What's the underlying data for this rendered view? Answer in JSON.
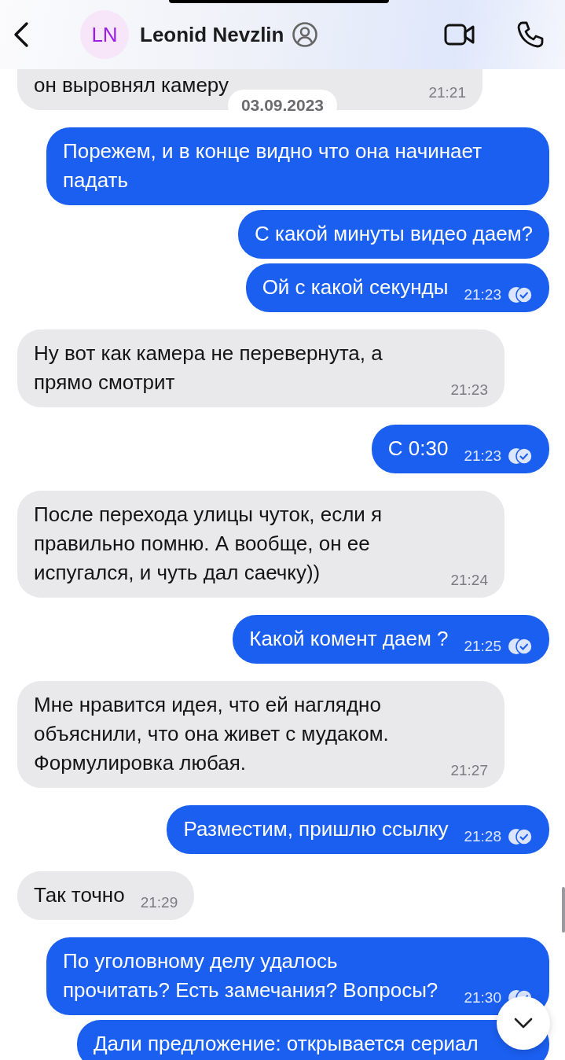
{
  "header": {
    "initials": "LN",
    "name": "Leonid Nevzlin"
  },
  "messages": [
    {
      "kind": "incoming",
      "text": "он выровнял камеру",
      "time": "21:21"
    },
    {
      "kind": "date",
      "text": "03.09.2023"
    },
    {
      "kind": "outgoing",
      "text": "Порежем, и в конце видно что она начинает падать"
    },
    {
      "kind": "outgoing",
      "text": "С какой минуты видео даем?"
    },
    {
      "kind": "outgoing",
      "text": "Ой с какой секунды",
      "time": "21:23",
      "read": true
    },
    {
      "kind": "incoming",
      "text": "Ну вот как камера не перевернута, а прямо смотрит",
      "time": "21:23"
    },
    {
      "kind": "outgoing",
      "text": "С 0:30",
      "time": "21:23",
      "read": true
    },
    {
      "kind": "incoming",
      "text": "После перехода улицы чуток, если я правильно помню. А вообще, он ее испугался, и чуть дал саечку))",
      "time": "21:24"
    },
    {
      "kind": "outgoing",
      "text": "Какой комент даем ?",
      "time": "21:25",
      "read": true
    },
    {
      "kind": "incoming",
      "text": "Мне нравится идея, что ей наглядно объяснили, что она живет с мудаком. Формулировка любая.",
      "time": "21:27"
    },
    {
      "kind": "outgoing",
      "text": "Разместим, пришлю ссылку",
      "time": "21:28",
      "read": true
    },
    {
      "kind": "incoming",
      "text": "Так точно",
      "time": "21:29"
    },
    {
      "kind": "outgoing",
      "text": "По уголовному делу удалось прочитать? Есть замечания? Вопросы?",
      "time": "21:30",
      "read": true
    },
    {
      "kind": "outgoing",
      "text": "Дали предложение: открывается сериал"
    }
  ]
}
